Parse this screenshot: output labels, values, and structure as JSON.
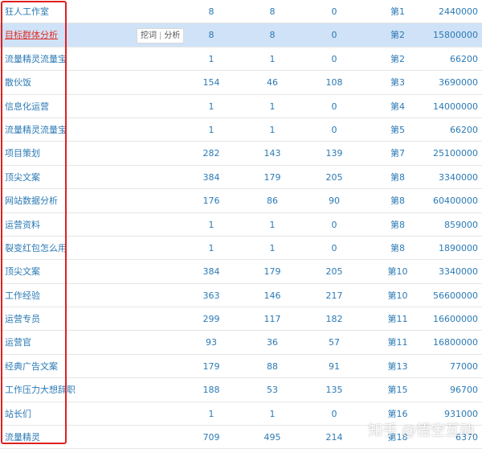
{
  "rows": [
    {
      "keyword": "狂人工作室",
      "v1": "8",
      "v2": "8",
      "v3": "0",
      "rank": "第1",
      "volume": "2440000"
    },
    {
      "keyword": "目标群体分析",
      "v1": "8",
      "v2": "8",
      "v3": "0",
      "rank": "第2",
      "volume": "15800000",
      "selected": true
    },
    {
      "keyword": "流量精灵流量宝",
      "v1": "1",
      "v2": "1",
      "v3": "0",
      "rank": "第2",
      "volume": "66200"
    },
    {
      "keyword": "散伙饭",
      "v1": "154",
      "v2": "46",
      "v3": "108",
      "rank": "第3",
      "volume": "3690000"
    },
    {
      "keyword": "信息化运营",
      "v1": "1",
      "v2": "1",
      "v3": "0",
      "rank": "第4",
      "volume": "14000000"
    },
    {
      "keyword": "流量精灵流量宝",
      "v1": "1",
      "v2": "1",
      "v3": "0",
      "rank": "第5",
      "volume": "66200"
    },
    {
      "keyword": "项目策划",
      "v1": "282",
      "v2": "143",
      "v3": "139",
      "rank": "第7",
      "volume": "25100000"
    },
    {
      "keyword": "顶尖文案",
      "v1": "384",
      "v2": "179",
      "v3": "205",
      "rank": "第8",
      "volume": "3340000"
    },
    {
      "keyword": "网站数据分析",
      "v1": "176",
      "v2": "86",
      "v3": "90",
      "rank": "第8",
      "volume": "60400000"
    },
    {
      "keyword": "运营资料",
      "v1": "1",
      "v2": "1",
      "v3": "0",
      "rank": "第8",
      "volume": "859000"
    },
    {
      "keyword": "裂变红包怎么用",
      "v1": "1",
      "v2": "1",
      "v3": "0",
      "rank": "第8",
      "volume": "1890000"
    },
    {
      "keyword": "顶尖文案",
      "v1": "384",
      "v2": "179",
      "v3": "205",
      "rank": "第10",
      "volume": "3340000"
    },
    {
      "keyword": "工作经验",
      "v1": "363",
      "v2": "146",
      "v3": "217",
      "rank": "第10",
      "volume": "56600000"
    },
    {
      "keyword": "运营专员",
      "v1": "299",
      "v2": "117",
      "v3": "182",
      "rank": "第11",
      "volume": "16600000"
    },
    {
      "keyword": "运营官",
      "v1": "93",
      "v2": "36",
      "v3": "57",
      "rank": "第11",
      "volume": "16800000"
    },
    {
      "keyword": "经典广告文案",
      "v1": "179",
      "v2": "88",
      "v3": "91",
      "rank": "第13",
      "volume": "77000"
    },
    {
      "keyword": "工作压力大想辞职",
      "v1": "188",
      "v2": "53",
      "v3": "135",
      "rank": "第15",
      "volume": "96700"
    },
    {
      "keyword": "站长们",
      "v1": "1",
      "v2": "1",
      "v3": "0",
      "rank": "第16",
      "volume": "931000"
    },
    {
      "keyword": "流量精灵",
      "v1": "709",
      "v2": "495",
      "v3": "214",
      "rank": "第18",
      "volume": "6370"
    }
  ],
  "row_actions": {
    "dig": "挖词",
    "separator": "|",
    "analyze": "分析"
  },
  "watermark": "知乎 @悟空互动",
  "colors": {
    "link": "#2b7ab5",
    "selected_bg": "#cfe2f7",
    "selected_text": "#e0302a",
    "highlight_border": "#e02020"
  }
}
